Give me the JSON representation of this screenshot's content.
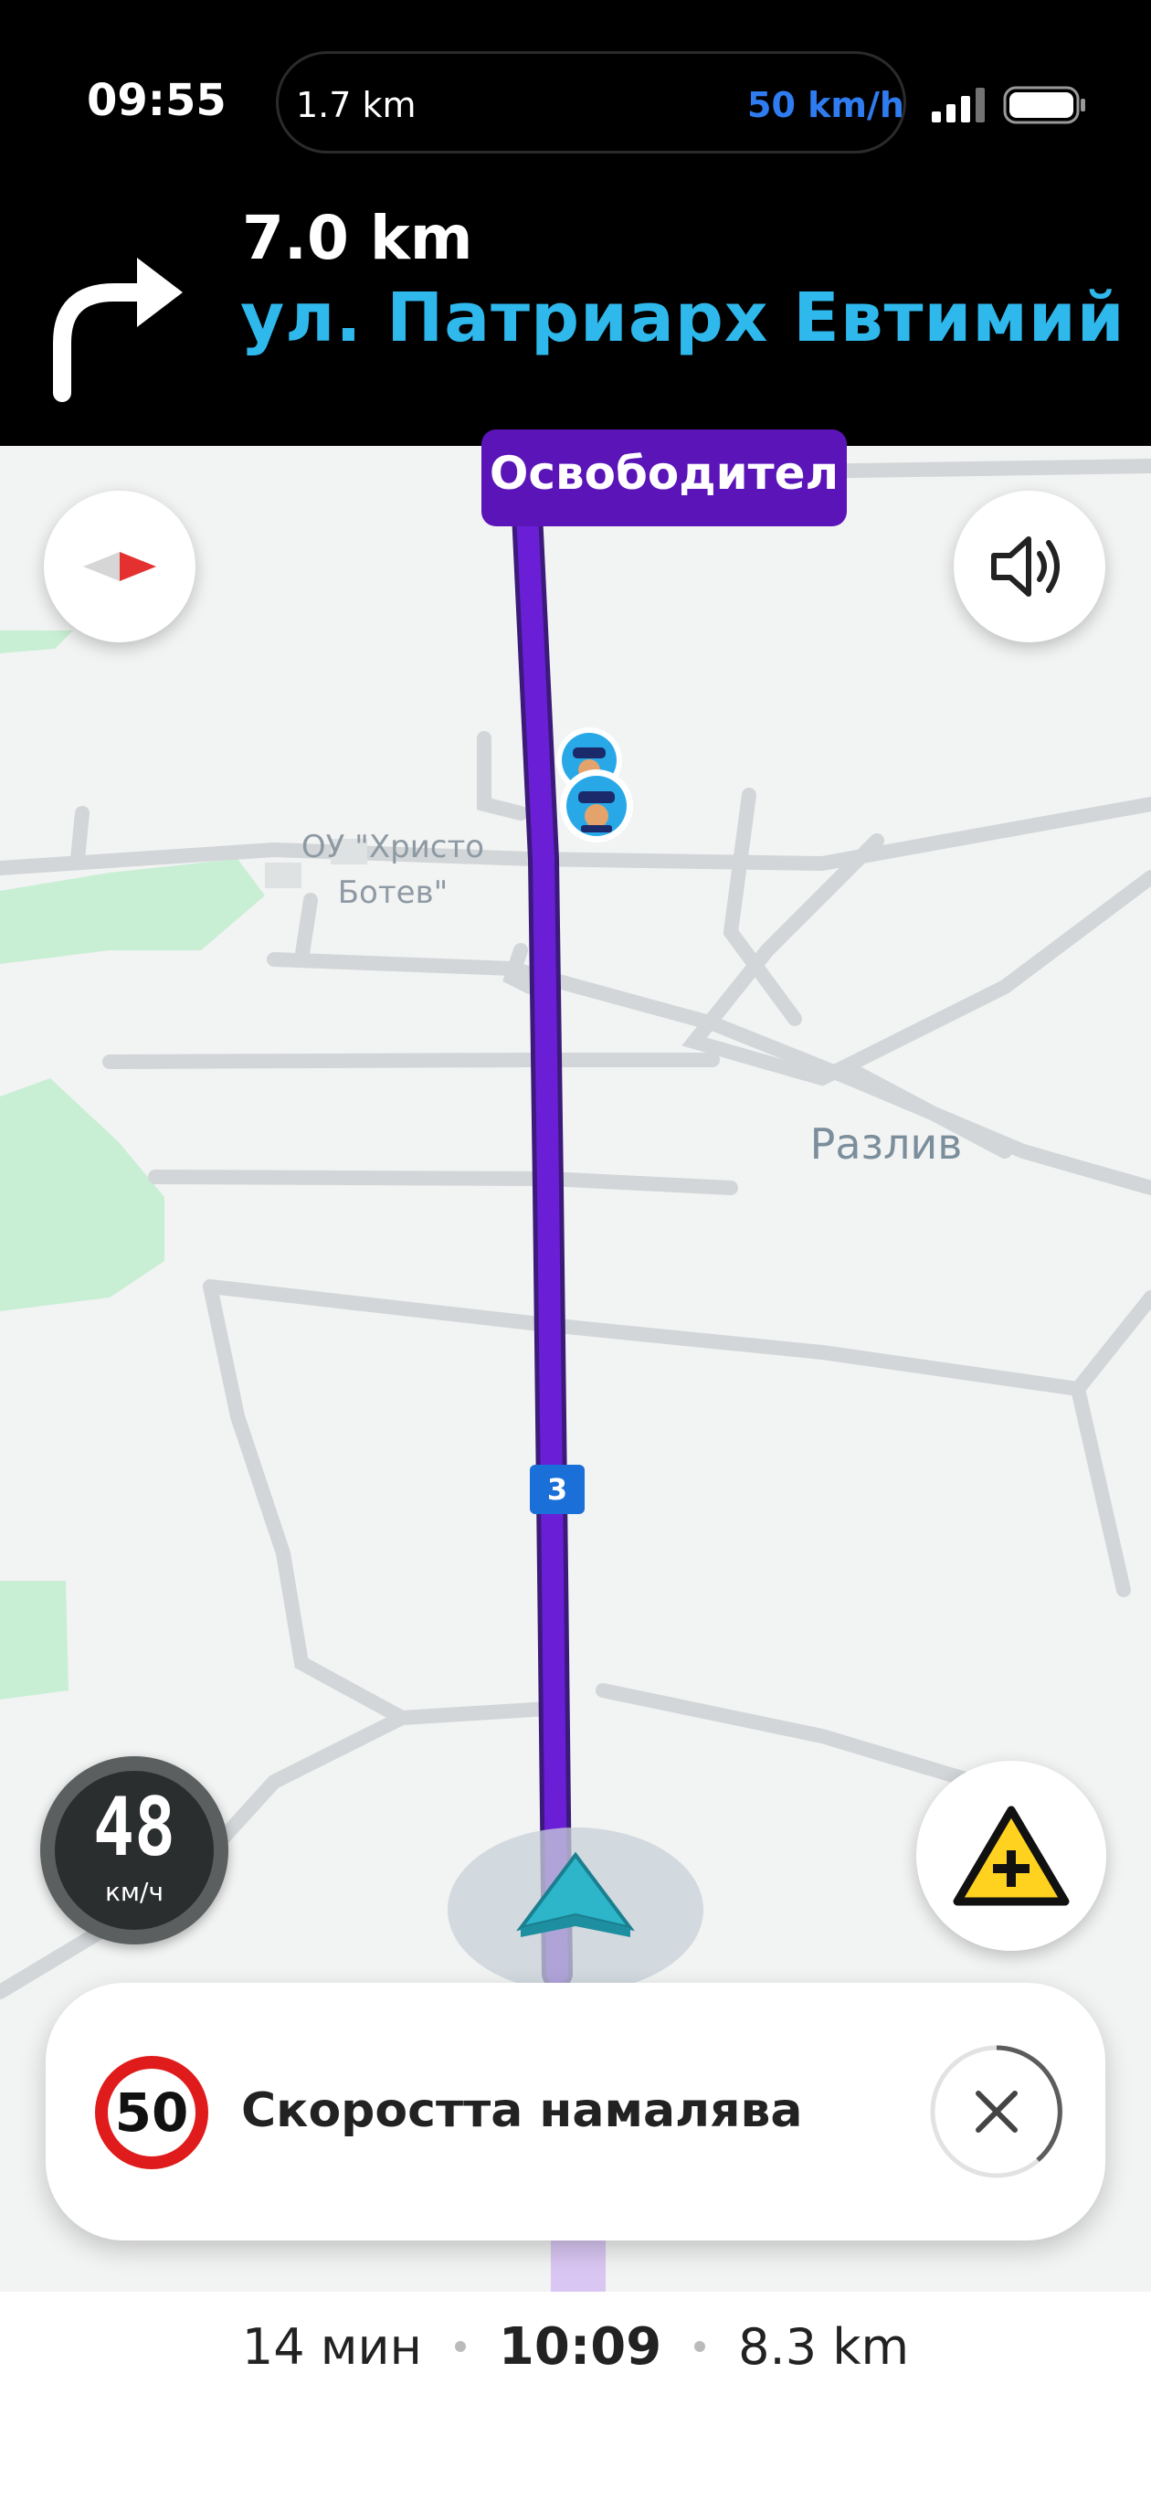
{
  "status_bar": {
    "time": "09:55",
    "island": {
      "distance": "1.7 km",
      "speed": "50 km/h"
    }
  },
  "navigation": {
    "next_turn": "right",
    "distance": "7.0 km",
    "street": "ул. Патриарх Евтимий"
  },
  "map": {
    "current_street_sign": "Освободител",
    "poi_label": "ОУ \"Христо Ботев\"",
    "town_label": "Разлив",
    "route_shield": "3",
    "route_color": "#6a1fd6"
  },
  "speedometer": {
    "speed": "48",
    "unit": "км/ч"
  },
  "alert": {
    "speed_limit": "50",
    "message": "Скоростта намалява"
  },
  "trip": {
    "duration": "14 мин",
    "arrival_time": "10:09",
    "distance": "8.3 km"
  },
  "icons": [
    "compass-icon",
    "volume-icon",
    "report-hazard-icon",
    "close-icon",
    "police-icon",
    "turn-right-arrow-icon",
    "position-arrow-icon"
  ]
}
